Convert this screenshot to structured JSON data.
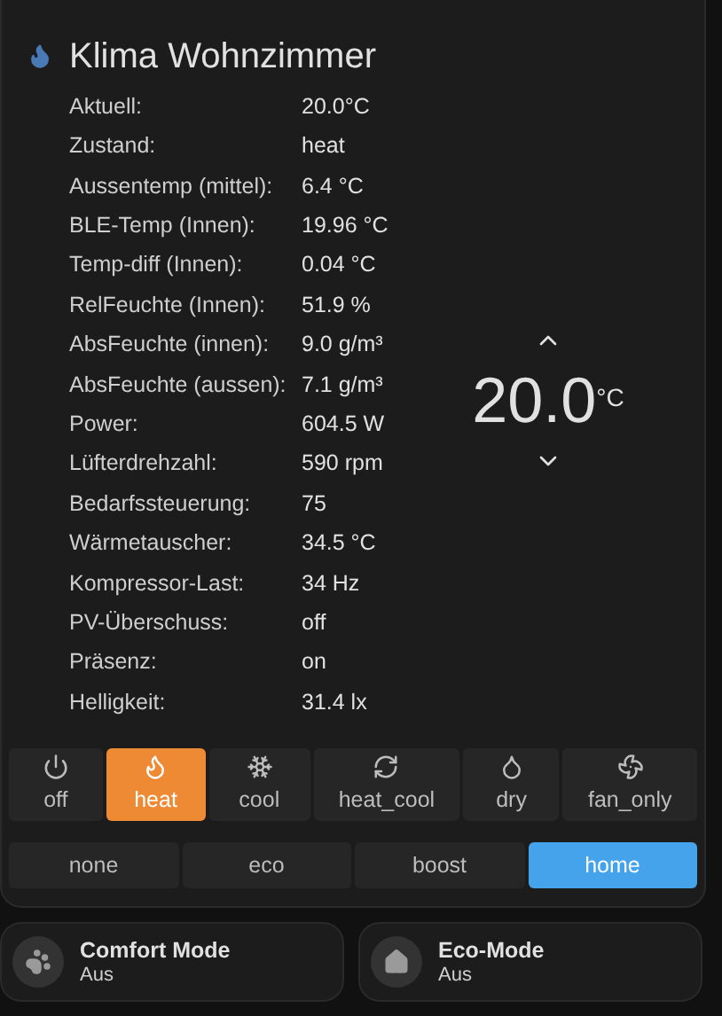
{
  "card": {
    "title": "Klima Wohnzimmer",
    "attributes": [
      {
        "label": "Aktuell:",
        "value": "20.0°C"
      },
      {
        "label": "Zustand:",
        "value": "heat"
      },
      {
        "label": "Aussentemp (mittel):",
        "value": "6.4 °C"
      },
      {
        "label": "BLE-Temp (Innen):",
        "value": "19.96 °C"
      },
      {
        "label": "Temp-diff (Innen):",
        "value": "0.04 °C"
      },
      {
        "label": "RelFeuchte (Innen):",
        "value": "51.9 %"
      },
      {
        "label": "AbsFeuchte (innen):",
        "value": "9.0 g/m³"
      },
      {
        "label": "AbsFeuchte (aussen):",
        "value": "7.1 g/m³"
      },
      {
        "label": "Power:",
        "value": "604.5 W"
      },
      {
        "label": "Lüfterdrehzahl:",
        "value": "590 rpm"
      },
      {
        "label": "Bedarfssteuerung:",
        "value": "75"
      },
      {
        "label": "Wärmetauscher:",
        "value": "34.5 °C"
      },
      {
        "label": "Kompressor-Last:",
        "value": "34 Hz"
      },
      {
        "label": "PV-Überschuss:",
        "value": "off"
      },
      {
        "label": "Präsenz:",
        "value": "on"
      },
      {
        "label": "Helligkeit:",
        "value": "31.4 lx"
      }
    ],
    "target": {
      "value": "20.0",
      "unit": "°C"
    },
    "hvac_modes": [
      {
        "kind": "off",
        "label": "off",
        "selected": false
      },
      {
        "kind": "heat",
        "label": "heat",
        "selected": true
      },
      {
        "kind": "cool",
        "label": "cool",
        "selected": false
      },
      {
        "kind": "heat_cool",
        "label": "heat_cool",
        "selected": false
      },
      {
        "kind": "dry",
        "label": "dry",
        "selected": false
      },
      {
        "kind": "fan_only",
        "label": "fan_only",
        "selected": false
      }
    ],
    "presets": [
      {
        "label": "none",
        "selected": false
      },
      {
        "label": "eco",
        "selected": false
      },
      {
        "label": "boost",
        "selected": false
      },
      {
        "label": "home",
        "selected": true
      }
    ]
  },
  "tiles": [
    {
      "kind": "comfort",
      "name": "Comfort Mode",
      "state": "Aus"
    },
    {
      "kind": "eco",
      "name": "Eco-Mode",
      "state": "Aus"
    }
  ]
}
